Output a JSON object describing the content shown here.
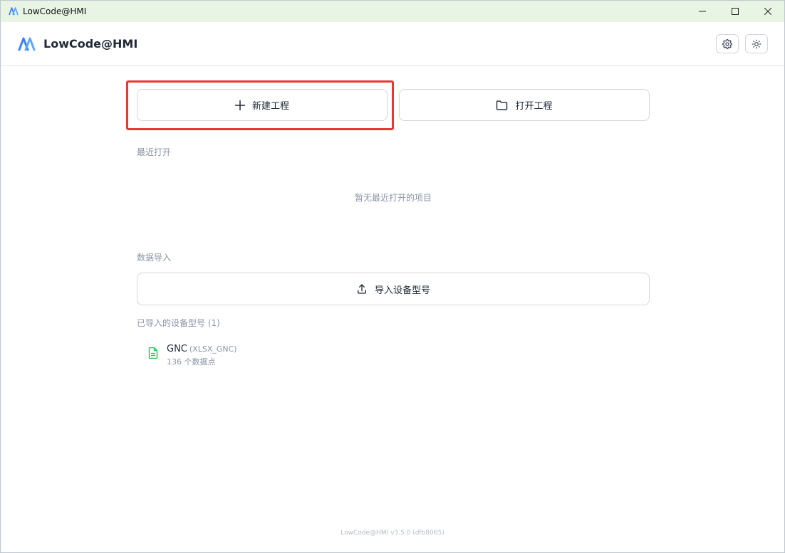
{
  "window": {
    "title": "LowCode@HMI",
    "controls": [
      "minimize-icon",
      "maximize-icon",
      "close-icon"
    ]
  },
  "header": {
    "brand": "LowCode@HMI",
    "actions": [
      "gear-icon",
      "sun-icon"
    ]
  },
  "actions": {
    "new_project": "新建工程",
    "open_project": "打开工程"
  },
  "recent": {
    "label": "最近打开",
    "empty": "暂无最近打开的项目"
  },
  "import": {
    "label": "数据导入",
    "button": "导入设备型号",
    "imported_label": "已导入的设备型号 (1)",
    "devices": [
      {
        "name": "GNC",
        "code": "(XLSX_GNC)",
        "points": "136 个数据点"
      }
    ]
  },
  "footer": "LowCode@HMI v3.5.0 (dfb8065)",
  "colors": {
    "titlebar": "#e9f5e4",
    "highlight": "#e53935",
    "brand_blue": "#3b82f6",
    "file_green": "#22c55e"
  }
}
